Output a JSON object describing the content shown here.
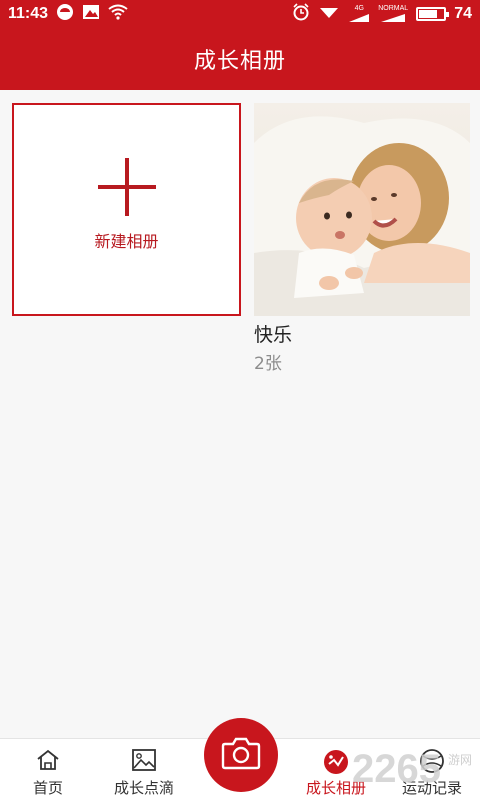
{
  "status_bar": {
    "time": "11:43",
    "signal_label_1": "4G",
    "signal_label_2": "NORMAL",
    "battery": "74",
    "battery_level": 0.74
  },
  "header": {
    "title": "成长相册"
  },
  "new_album": {
    "label": "新建相册"
  },
  "albums": [
    {
      "name": "快乐",
      "count": "2张"
    }
  ],
  "bottom_nav": {
    "items": [
      {
        "label": "首页",
        "icon": "home-icon"
      },
      {
        "label": "成长点滴",
        "icon": "image-icon"
      },
      {
        "label": "成长相册",
        "icon": "album-icon",
        "active": true
      },
      {
        "label": "运动记录",
        "icon": "sport-icon"
      }
    ],
    "camera_icon": "camera-icon"
  },
  "watermark": {
    "text": "2265",
    "suffix": "游网"
  },
  "colors": {
    "brand": "#c8161d",
    "muted": "#8c8c8c"
  }
}
